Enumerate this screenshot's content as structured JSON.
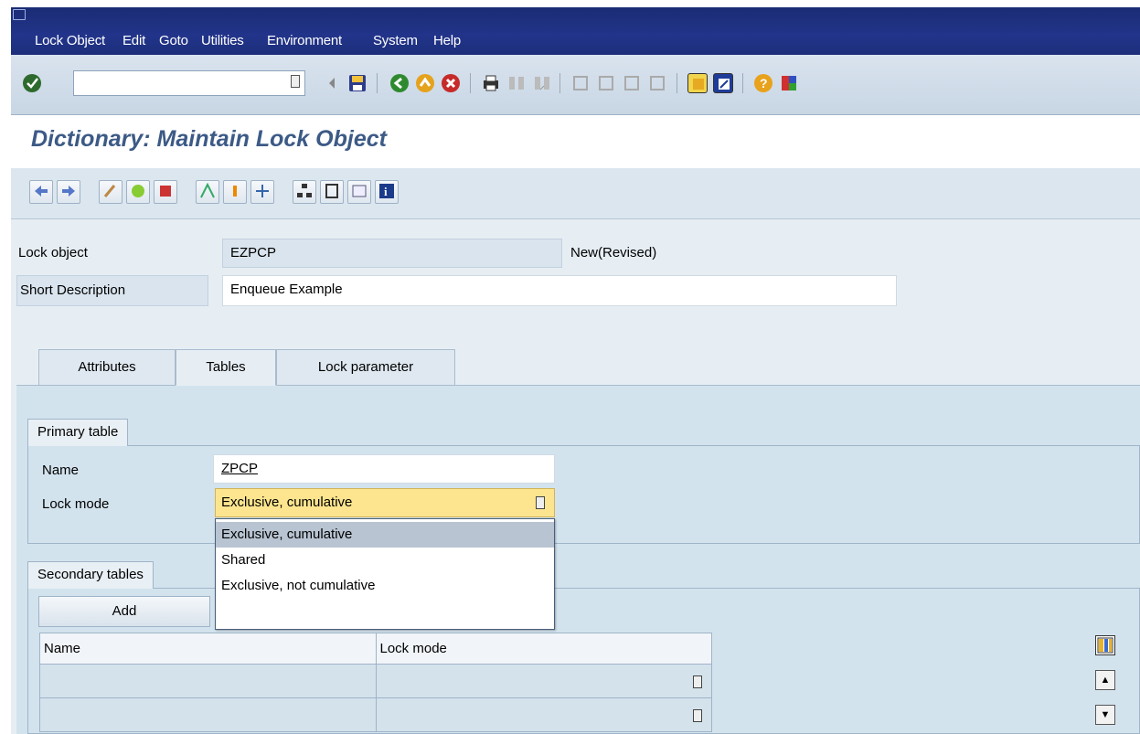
{
  "menu": {
    "items": [
      "Lock Object",
      "Edit",
      "Goto",
      "Utilities",
      "Environment",
      "System",
      "Help"
    ]
  },
  "toolbar": {
    "command_field_value": "",
    "icons": [
      "enter-icon",
      "save-icon",
      "back-icon",
      "exit-icon",
      "cancel-icon",
      "print-icon",
      "find-icon",
      "find-next-icon",
      "first-page-icon",
      "prev-page-icon",
      "next-page-icon",
      "last-page-icon",
      "create-session-icon",
      "shortcut-icon",
      "help-icon",
      "layout-icon"
    ]
  },
  "title": "Dictionary: Maintain Lock Object",
  "app_toolbar_icons": [
    "back-arrow-icon",
    "forward-arrow-icon",
    "display-change-icon",
    "check-icon",
    "activate-icon",
    "where-used-icon",
    "object-list-icon",
    "navigation-icon",
    "hierarchy-icon",
    "documentation-icon",
    "display-object-icon",
    "info-icon"
  ],
  "header": {
    "lock_object_label": "Lock object",
    "lock_object_value": "EZPCP",
    "status": "New(Revised)",
    "short_desc_label": "Short Description",
    "short_desc_value": "Enqueue Example"
  },
  "tabs": [
    {
      "label": "Attributes",
      "active": false
    },
    {
      "label": "Tables",
      "active": true
    },
    {
      "label": "Lock parameter",
      "active": false
    }
  ],
  "primary_table": {
    "title": "Primary table",
    "name_label": "Name",
    "name_value": "ZPCP",
    "lock_mode_label": "Lock mode",
    "lock_mode_value": "Exclusive, cumulative"
  },
  "dropdown": {
    "options": [
      "Exclusive, cumulative",
      "Shared",
      "Exclusive, not cumulative"
    ],
    "selected_index": 0
  },
  "secondary_tables": {
    "title": "Secondary tables",
    "add_button": "Add",
    "columns": [
      "Name",
      "Lock mode"
    ],
    "rows": [
      {
        "name": "",
        "lock_mode": ""
      },
      {
        "name": "",
        "lock_mode": ""
      }
    ]
  }
}
